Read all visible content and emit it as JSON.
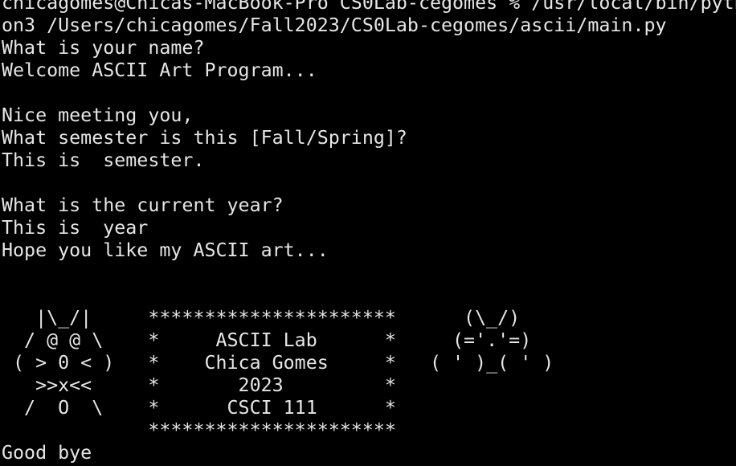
{
  "terminal": {
    "background": "#000000",
    "foreground": "#e6e6e6",
    "lines": [
      "chicagomes@Chicas-MacBook-Pro CS0Lab-cegomes % /usr/local/bin/pyth",
      "on3 /Users/chicagomes/Fall2023/CS0Lab-cegomes/ascii/main.py",
      "What is your name?",
      "Welcome ASCII Art Program...",
      "",
      "Nice meeting you,",
      "What semester is this [Fall/Spring]?",
      "This is  semester.",
      "",
      "What is the current year?",
      "This is  year",
      "Hope you like my ASCII art...",
      "",
      "",
      "   |\\_/|     **********************      (\\_/)",
      "  / @ @ \\    *     ASCII Lab      *     (='.'=)",
      " ( > 0 < )   *    Chica Gomes     *   ( ' )_( ' )",
      "   >>x<<     *       2023         *",
      "  /  O  \\    *      CSCI 111      *",
      "             **********************",
      "Good bye"
    ]
  }
}
